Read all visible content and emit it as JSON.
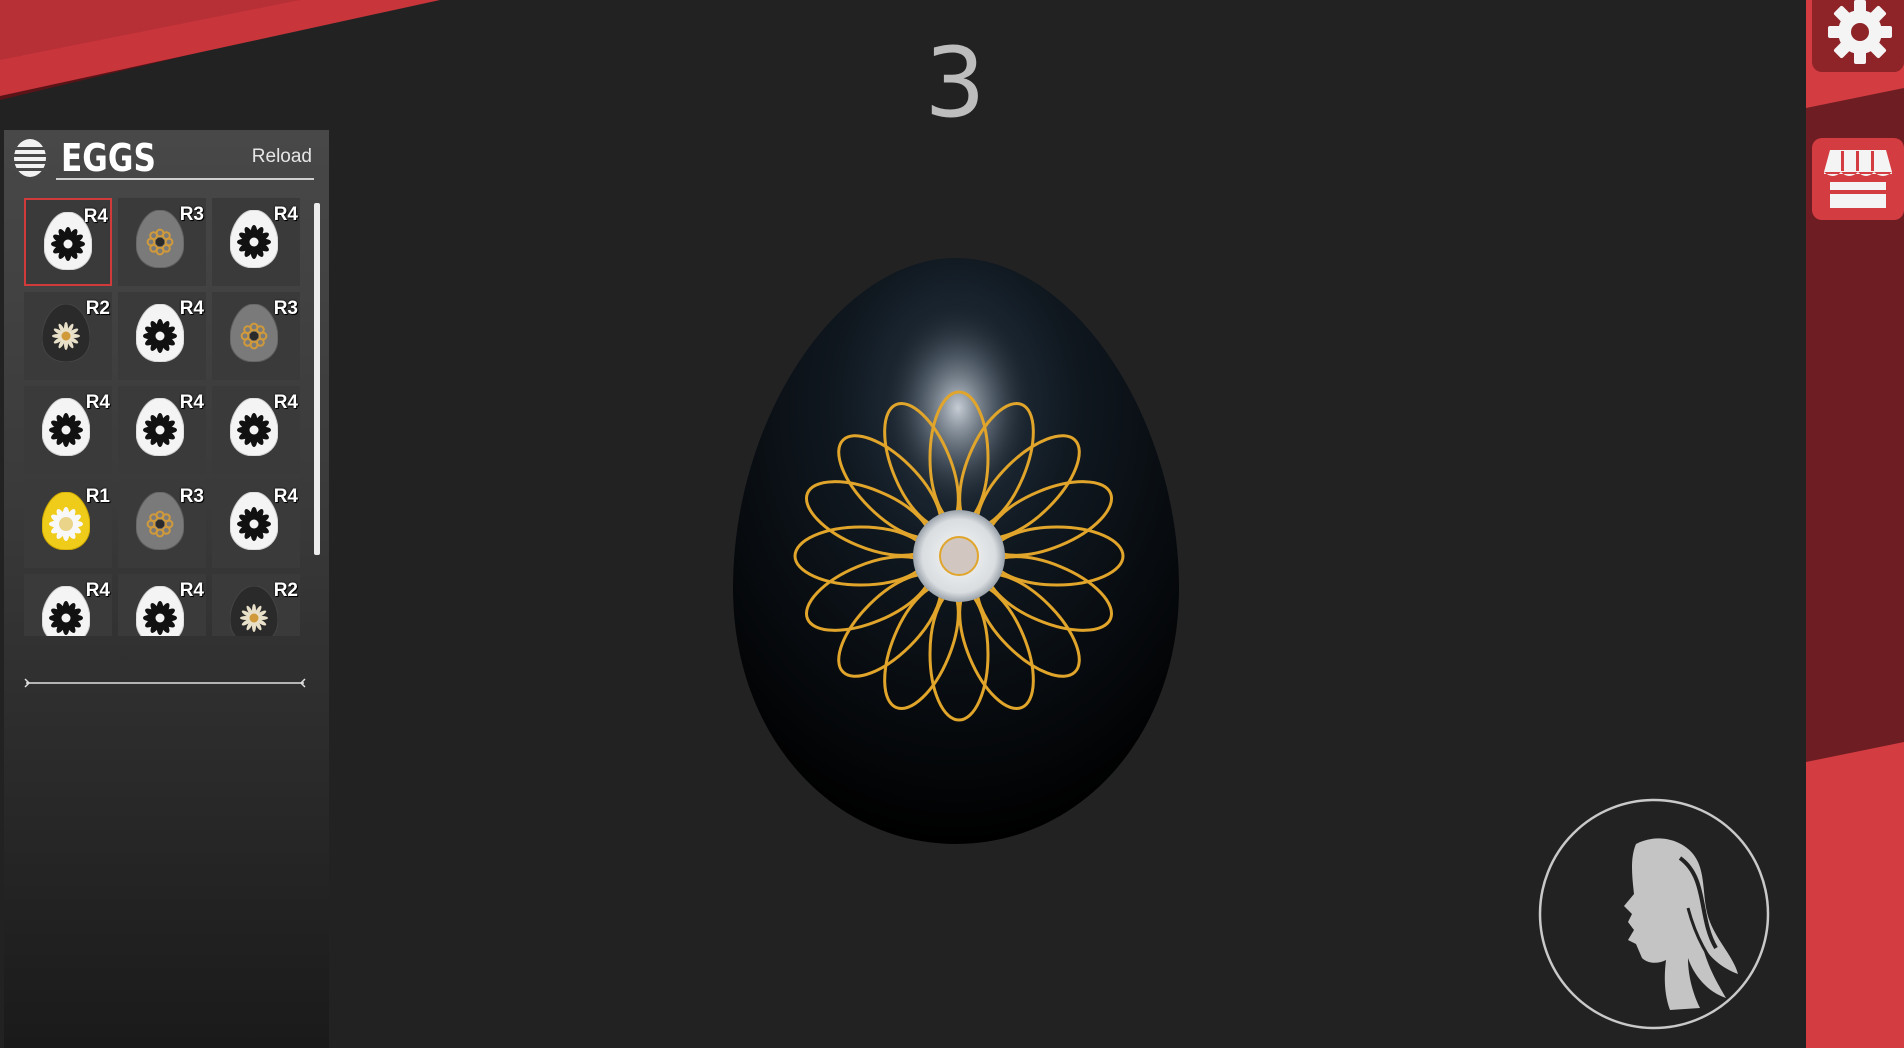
{
  "counter": "3",
  "panel": {
    "title": "EGGS",
    "reload_label": "Reload"
  },
  "eggs": [
    {
      "rank": "R4",
      "style": "white-daisy",
      "selected": true
    },
    {
      "rank": "R3",
      "style": "gray-ornate"
    },
    {
      "rank": "R4",
      "style": "white-daisy"
    },
    {
      "rank": "R2",
      "style": "dark-star"
    },
    {
      "rank": "R4",
      "style": "white-daisy"
    },
    {
      "rank": "R3",
      "style": "gray-ornate"
    },
    {
      "rank": "R4",
      "style": "white-daisy"
    },
    {
      "rank": "R4",
      "style": "white-daisy"
    },
    {
      "rank": "R4",
      "style": "white-daisy"
    },
    {
      "rank": "R1",
      "style": "yellow-flower"
    },
    {
      "rank": "R3",
      "style": "gray-ornate"
    },
    {
      "rank": "R4",
      "style": "white-daisy"
    },
    {
      "rank": "R4",
      "style": "white-daisy"
    },
    {
      "rank": "R4",
      "style": "white-daisy"
    },
    {
      "rank": "R2",
      "style": "dark-star"
    }
  ],
  "colors": {
    "accent_red": "#d63c41",
    "dark_red": "#7a1f24",
    "background": "#222222",
    "gold": "#e0a52a"
  },
  "icons": {
    "settings": "gear-icon",
    "shop": "shop-stall-icon",
    "profile": "woman-profile-icon",
    "panel": "egg-stack-icon"
  }
}
